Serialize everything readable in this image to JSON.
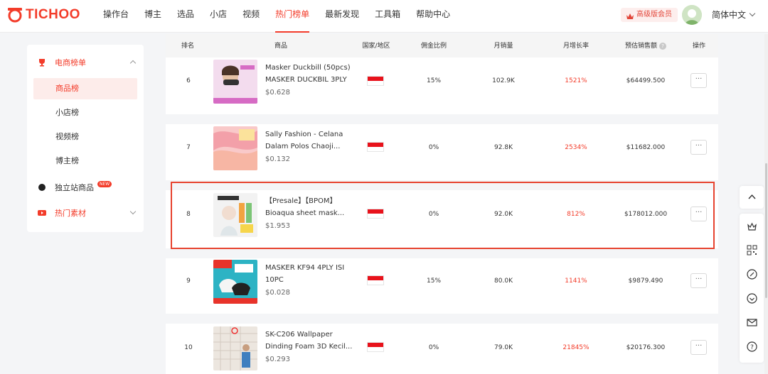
{
  "header": {
    "logo": "TICHOO",
    "nav": [
      "操作台",
      "博主",
      "选品",
      "小店",
      "视频",
      "热门榜单",
      "最新发现",
      "工具箱",
      "帮助中心"
    ],
    "active_nav": "热门榜单",
    "vip_label": "高级版会员",
    "language": "简体中文"
  },
  "sidebar": {
    "group1": "电商榜单",
    "items": [
      "商品榜",
      "小店榜",
      "视频榜",
      "博主榜"
    ],
    "active_item": "商品榜",
    "group2": "独立站商品",
    "new_badge": "NEW",
    "group3": "热门素材"
  },
  "table": {
    "columns": [
      "排名",
      "商品",
      "国家/地区",
      "佣金比例",
      "月销量",
      "月增长率",
      "预估销售额",
      "操作"
    ],
    "rows": [
      {
        "rank": "6",
        "name1": "Masker Duckbill (50pcs)",
        "name2": "MASKER DUCKBIL 3PLY",
        "price": "$0.628",
        "commission": "15%",
        "sales": "102.9K",
        "growth": "1521%",
        "revenue": "$64499.500",
        "action": "···"
      },
      {
        "rank": "7",
        "name1": "Sally Fashion - Celana",
        "name2": "Dalam Polos Chaoji...",
        "price": "$0.132",
        "commission": "0%",
        "sales": "92.8K",
        "growth": "2534%",
        "revenue": "$11682.000",
        "action": "···"
      },
      {
        "rank": "8",
        "name1": "【Presale】【BPOM】",
        "name2": "Bioaqua sheet mask...",
        "price": "$1.953",
        "commission": "0%",
        "sales": "92.0K",
        "growth": "812%",
        "revenue": "$178012.000",
        "action": "···"
      },
      {
        "rank": "9",
        "name1": "MASKER KF94 4PLY ISI",
        "name2": "10PC",
        "price": "$0.028",
        "commission": "15%",
        "sales": "80.0K",
        "growth": "1141%",
        "revenue": "$9879.490",
        "action": "···"
      },
      {
        "rank": "10",
        "name1": "SK-C206 Wallpaper",
        "name2": "Dinding Foam 3D Kecil...",
        "price": "$0.293",
        "commission": "0%",
        "sales": "79.0K",
        "growth": "21845%",
        "revenue": "$20176.300",
        "action": "···"
      }
    ]
  },
  "colors": {
    "brand": "#f33c2a",
    "growth_red": "#f33c2a",
    "highlight_border": "#e7432f"
  },
  "icons": {
    "logo": "tichoo-logo-icon",
    "float": [
      "arrow-up-icon",
      "crown-outline-icon",
      "qr-code-icon",
      "link-icon",
      "heart-smile-icon",
      "mail-icon",
      "help-icon"
    ]
  }
}
